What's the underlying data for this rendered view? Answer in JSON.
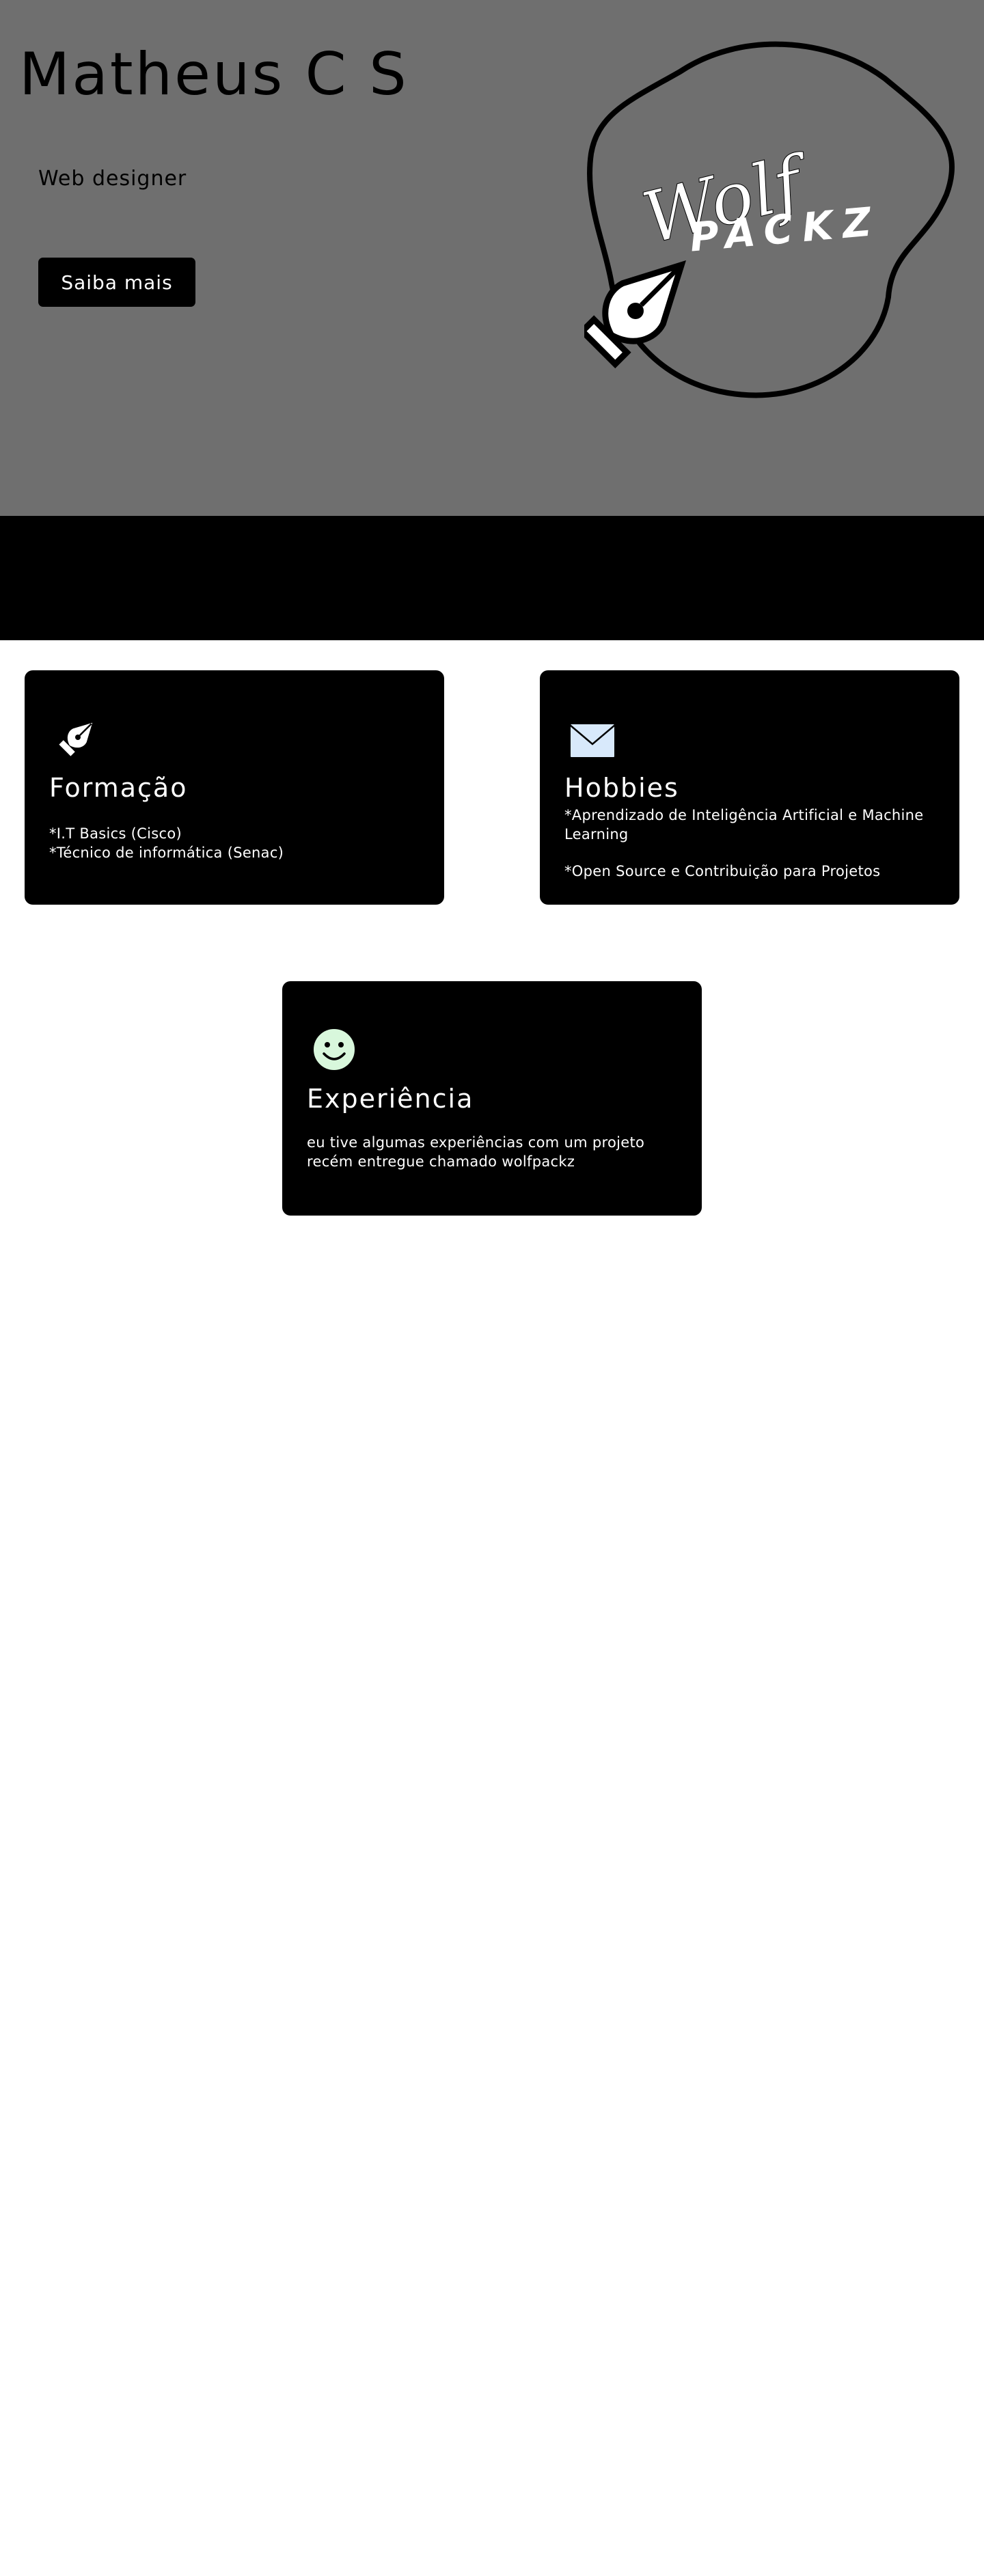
{
  "hero": {
    "title": "Matheus C S",
    "subtitle": "Web designer",
    "button_label": "Saiba mais",
    "background": "#6f6f6f",
    "logo": {
      "script_text": "Wolf",
      "block_text": "PACKZ",
      "icon": "pen-nib-icon"
    }
  },
  "cards": {
    "formacao": {
      "icon": "pen-nib-icon",
      "title": "Formação",
      "lines": [
        "*I.T Basics (Cisco)",
        "*Técnico de informática (Senac)"
      ]
    },
    "hobbies": {
      "icon": "envelope-icon",
      "title": "Hobbies",
      "lines": [
        "*Aprendizado de Inteligência Artificial e Machine",
        "Learning",
        "*Open Source e Contribuição para Projetos"
      ]
    },
    "experiencia": {
      "icon": "smiley-icon",
      "title": "Experiência",
      "lines": [
        "eu tive algumas experiências com um projeto",
        "recém entregue chamado wolfpackz"
      ]
    }
  },
  "colors": {
    "accent": "#000000",
    "envelope": "#d8e9fb",
    "smiley": "#d8f7dc"
  }
}
